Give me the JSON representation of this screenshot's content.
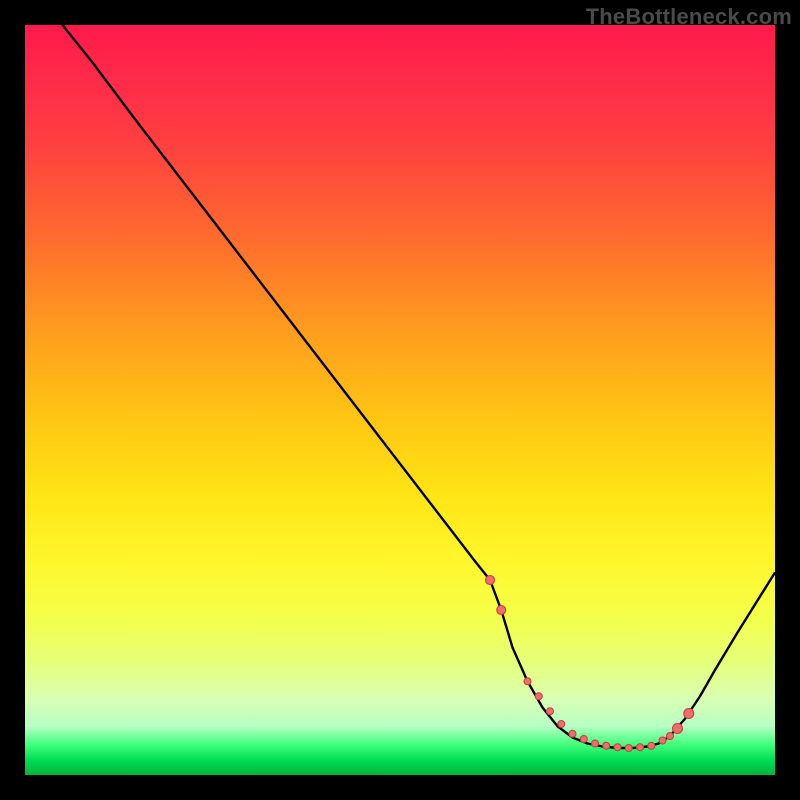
{
  "watermark": {
    "text": "TheBottleneck.com"
  },
  "colors": {
    "marker_fill": "#ef6d6a",
    "marker_stroke": "#c9403d",
    "curve": "#000000"
  },
  "chart_data": {
    "type": "line",
    "title": "",
    "xlabel": "",
    "ylabel": "",
    "xlim": [
      0,
      100
    ],
    "ylim": [
      0,
      100
    ],
    "grid": false,
    "legend_position": "none",
    "series": [
      {
        "name": "curve",
        "x": [
          5,
          9,
          15,
          20,
          25,
          30,
          35,
          40,
          45,
          50,
          55,
          60,
          62,
          63.5,
          65,
          67,
          69,
          71,
          73,
          75,
          77,
          79,
          81,
          83,
          84.5,
          86,
          88,
          90,
          92,
          95,
          100
        ],
        "y": [
          100,
          95,
          87,
          80.5,
          74,
          67.5,
          61,
          54.5,
          48,
          41.5,
          35,
          28.5,
          26,
          22,
          17,
          12.5,
          9,
          6.5,
          5,
          4.2,
          3.8,
          3.6,
          3.6,
          3.8,
          4.2,
          5.2,
          7.5,
          10.5,
          14,
          19,
          27
        ]
      }
    ],
    "markers": {
      "x": [
        62,
        63.5,
        67,
        68.5,
        70,
        71.5,
        73,
        74.5,
        76,
        77.5,
        79,
        80.5,
        82,
        83.5,
        85,
        86,
        87,
        88.5
      ],
      "y": [
        26,
        22,
        12.5,
        10.5,
        8.5,
        6.8,
        5.5,
        4.8,
        4.2,
        3.9,
        3.7,
        3.6,
        3.7,
        3.9,
        4.6,
        5.2,
        6.2,
        8.2
      ],
      "r": [
        4.5,
        4.5,
        3.5,
        3.5,
        3.5,
        3.5,
        3.5,
        3.5,
        3.5,
        3.5,
        3.5,
        3.5,
        3.5,
        3.5,
        3.5,
        3.5,
        5,
        5
      ]
    }
  }
}
